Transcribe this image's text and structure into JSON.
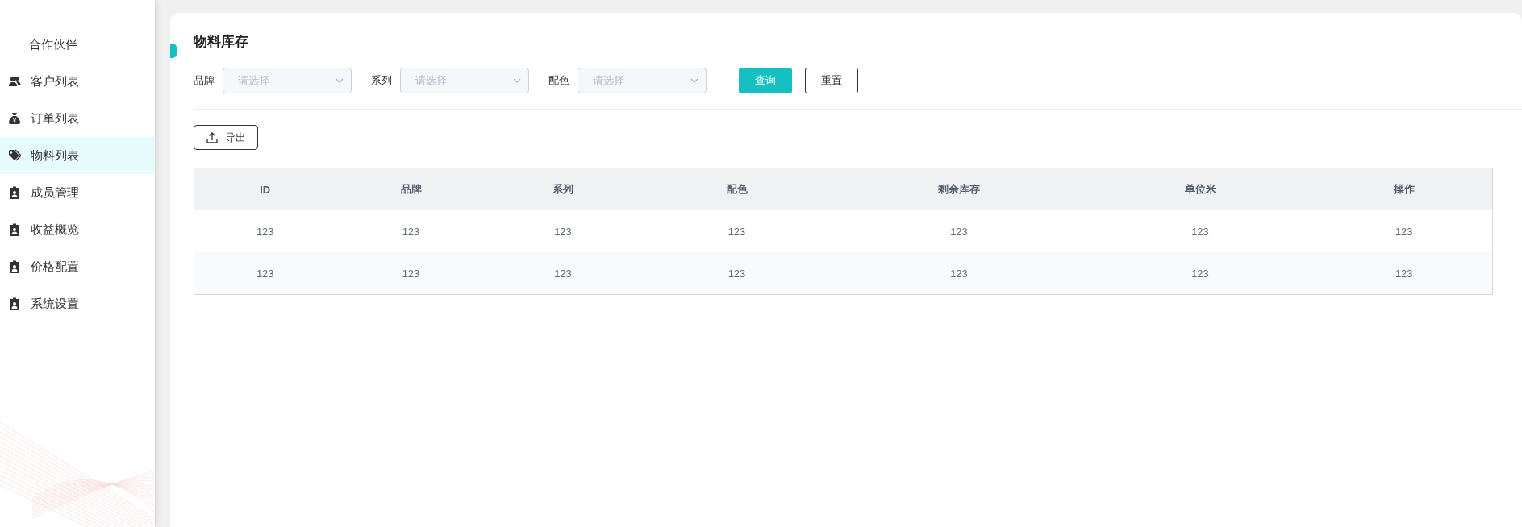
{
  "sidebar": {
    "header": "合作伙伴",
    "items": [
      {
        "label": "客户列表",
        "selected": false
      },
      {
        "label": "订单列表",
        "selected": false
      },
      {
        "label": "物料列表",
        "selected": true
      },
      {
        "label": "成员管理",
        "selected": false
      },
      {
        "label": "收益概览",
        "selected": false
      },
      {
        "label": "价格配置",
        "selected": false
      },
      {
        "label": "系统设置",
        "selected": false
      }
    ]
  },
  "page_title": "物料库存",
  "filters": [
    {
      "label": "品牌",
      "placeholder": "请选择"
    },
    {
      "label": "系列",
      "placeholder": "请选择"
    },
    {
      "label": "配色",
      "placeholder": "请选择"
    }
  ],
  "buttons": [
    {
      "label": "查询",
      "kind": "primary"
    },
    {
      "label": "重置",
      "kind": "default"
    }
  ],
  "export_button": "导出",
  "table": {
    "columns": [
      "ID",
      "品牌",
      "系列",
      "配色",
      "剩余库存",
      "单位米",
      "操作"
    ],
    "rows": [
      [
        "123",
        "123",
        "123",
        "123",
        "123",
        "123",
        "123"
      ],
      [
        "123",
        "123",
        "123",
        "123",
        "123",
        "123",
        "123"
      ]
    ]
  }
}
